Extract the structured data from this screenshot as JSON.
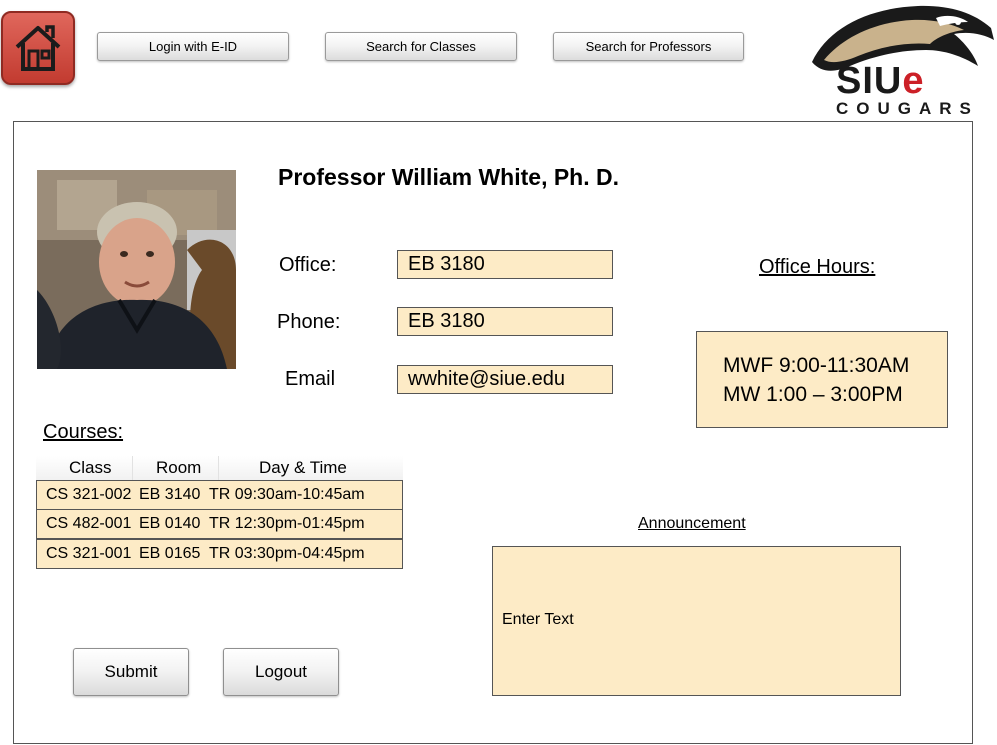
{
  "nav": {
    "home_icon": "house-icon",
    "login_label": "Login with E-ID",
    "search_classes_label": "Search for Classes",
    "search_professors_label": "Search for Professors"
  },
  "logo": {
    "siu": "SIU",
    "e": "e",
    "sub": "COUGARS"
  },
  "professor": {
    "name": "Professor William White, Ph. D.",
    "office_label": "Office:",
    "office_value": "EB 3180",
    "phone_label": "Phone:",
    "phone_value": "EB 3180",
    "email_label": "Email",
    "email_value": "wwhite@siue.edu"
  },
  "office_hours": {
    "title": "Office Hours:",
    "line1": "MWF 9:00-11:30AM",
    "line2": "MW 1:00 – 3:00PM"
  },
  "courses": {
    "title": "Courses:",
    "headers": [
      "Class",
      "Room",
      "Day & Time"
    ],
    "rows": [
      {
        "class": "CS 321-002",
        "room": "EB 3140",
        "time": "TR 09:30am-10:45am"
      },
      {
        "class": "CS 482-001",
        "room": "EB 0140",
        "time": "TR 12:30pm-01:45pm"
      },
      {
        "class": "CS 321-001",
        "room": "EB 0165",
        "time": "TR 03:30pm-04:45pm"
      }
    ]
  },
  "announcement": {
    "title": "Announcement",
    "placeholder": "Enter Text"
  },
  "actions": {
    "submit_label": "Submit",
    "logout_label": "Logout"
  },
  "colors": {
    "field_bg": "#fdebc6",
    "home_button": "#c23b30",
    "brand_red": "#cc2027"
  }
}
